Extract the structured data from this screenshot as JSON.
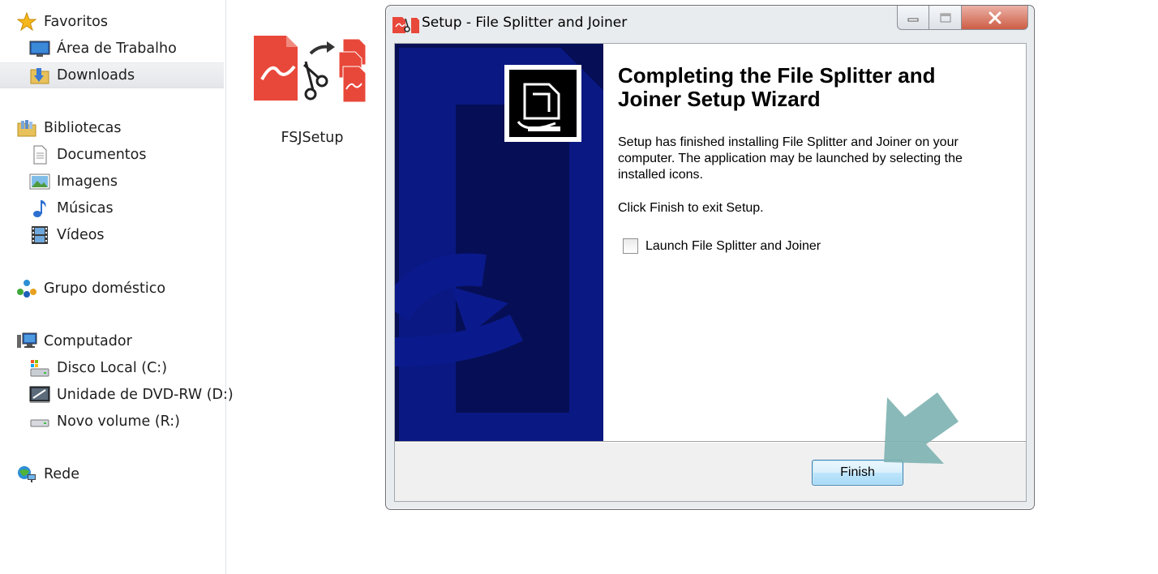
{
  "navigation": {
    "favorites": {
      "label": "Favoritos",
      "icon": "star-icon"
    },
    "desktop": {
      "label": "Área de Trabalho",
      "icon": "desktop-icon"
    },
    "downloads": {
      "label": "Downloads",
      "icon": "downloads-folder-icon"
    },
    "libraries": {
      "label": "Bibliotecas",
      "icon": "libraries-icon"
    },
    "documents": {
      "label": "Documentos",
      "icon": "documents-icon"
    },
    "pictures": {
      "label": "Imagens",
      "icon": "pictures-icon"
    },
    "music": {
      "label": "Músicas",
      "icon": "music-icon"
    },
    "videos": {
      "label": "Vídeos",
      "icon": "videos-icon"
    },
    "homegroup": {
      "label": "Grupo doméstico",
      "icon": "homegroup-icon"
    },
    "computer": {
      "label": "Computador",
      "icon": "computer-icon"
    },
    "local_disk": {
      "label": "Disco Local (C:)",
      "icon": "local-disk-icon"
    },
    "dvd_drive": {
      "label": "Unidade de DVD-RW (D:)",
      "icon": "dvd-drive-icon"
    },
    "new_volume": {
      "label": "Novo volume (R:)",
      "icon": "drive-icon"
    },
    "network": {
      "label": "Rede",
      "icon": "network-icon"
    }
  },
  "file": {
    "name": "FSJSetup",
    "icon": "file-splitter-icon"
  },
  "window": {
    "title": "Setup - File Splitter and Joiner",
    "heading": "Completing the File Splitter and Joiner Setup Wizard",
    "paragraph1": "Setup has finished installing File Splitter and Joiner on your computer. The application may be launched by selecting the installed icons.",
    "paragraph2": "Click Finish to exit Setup.",
    "launch_label": "Launch File Splitter and Joiner",
    "launch_checked": false,
    "finish_label": "Finish"
  },
  "colors": {
    "banner": "#060f55",
    "banner_shape": "#0a1a8c",
    "pointer_arrow": "#7fb3b2",
    "close_button": "#cd5d46",
    "finish_border": "#3c7fb1"
  }
}
